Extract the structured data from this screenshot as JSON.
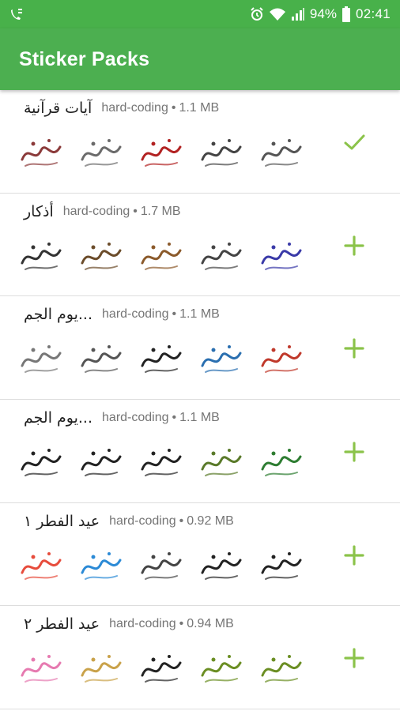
{
  "status_bar": {
    "battery_percent": "94%",
    "time": "02:41"
  },
  "app_bar": {
    "title": "Sticker Packs"
  },
  "colors": {
    "accent": "#4caf50",
    "action_icon": "#8bc34a",
    "divider": "#dddddd"
  },
  "packs": [
    {
      "name": "آيات قرآنية",
      "author": "hard-coding",
      "separator": "•",
      "size": "1.1 MB",
      "action": "added",
      "action_icon": "check-icon",
      "sticker_colors": [
        "#8b3a3a",
        "#6b6b6b",
        "#b22222",
        "#444444",
        "#555555"
      ]
    },
    {
      "name": "أذكار",
      "author": "hard-coding",
      "separator": "•",
      "size": "1.7 MB",
      "action": "add",
      "action_icon": "plus-icon",
      "sticker_colors": [
        "#333333",
        "#6b4c2a",
        "#8b5a2b",
        "#444444",
        "#3a3aa8"
      ]
    },
    {
      "name": "...يوم الجم",
      "author": "hard-coding",
      "separator": "•",
      "size": "1.1 MB",
      "action": "add",
      "action_icon": "plus-icon",
      "sticker_colors": [
        "#777777",
        "#555555",
        "#222222",
        "#2a6fb0",
        "#c0392b"
      ]
    },
    {
      "name": "...يوم الجم",
      "author": "hard-coding",
      "separator": "•",
      "size": "1.1 MB",
      "action": "add",
      "action_icon": "plus-icon",
      "sticker_colors": [
        "#222222",
        "#222222",
        "#222222",
        "#5a7a2a",
        "#2e7d32"
      ]
    },
    {
      "name": "عيد الفطر ١",
      "author": "hard-coding",
      "separator": "•",
      "size": "0.92 MB",
      "action": "add",
      "action_icon": "plus-icon",
      "sticker_colors": [
        "#e74c3c",
        "#2b8ad6",
        "#444444",
        "#222222",
        "#222222"
      ]
    },
    {
      "name": "عيد الفطر ٢",
      "author": "hard-coding",
      "separator": "•",
      "size": "0.94 MB",
      "action": "add",
      "action_icon": "plus-icon",
      "sticker_colors": [
        "#e67ab0",
        "#c9a24a",
        "#222222",
        "#6b8e23",
        "#6b8e23"
      ]
    }
  ]
}
